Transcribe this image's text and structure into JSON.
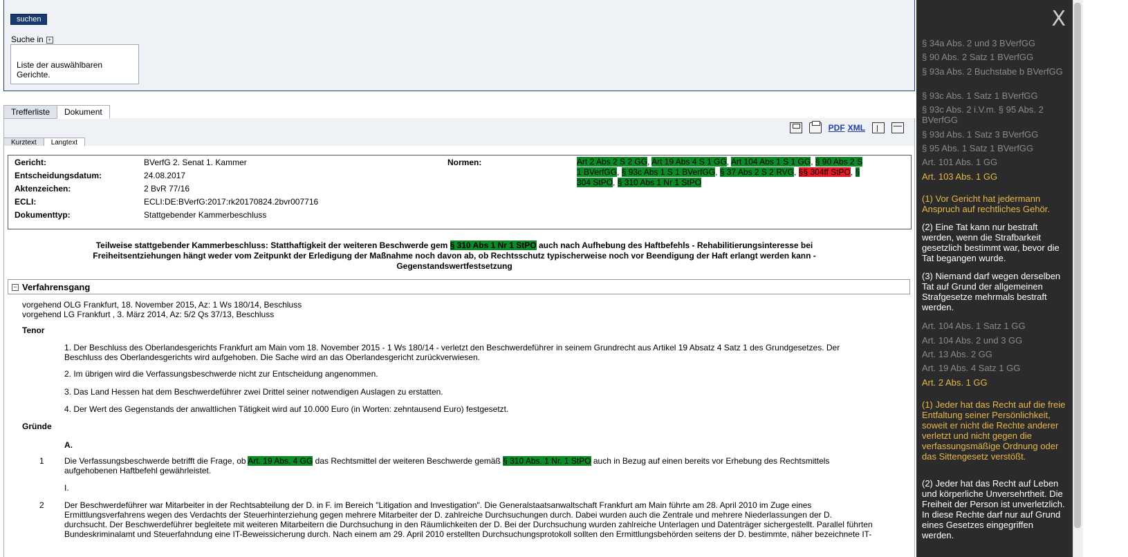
{
  "search": {
    "button_label": "suchen",
    "search_in_label": "Suche in",
    "plus_symbol": "+",
    "court_list_text": "Liste der auswählbaren Gerichte."
  },
  "tabs": [
    "Trefferliste",
    "Dokument"
  ],
  "subtabs": [
    "Kurztext",
    "Langtext"
  ],
  "toolbar": {
    "pdf_label": "PDF",
    "xml_label": "XML"
  },
  "meta": {
    "court_label": "Gericht:",
    "court_value": "BVerfG 2. Senat 1. Kammer",
    "date_label": "Entscheidungsdatum:",
    "date_value": "24.08.2017",
    "file_label": "Aktenzeichen:",
    "file_value": "2 BvR 77/16",
    "ecli_label": "ECLI:",
    "ecli_value": "ECLI:DE:BVerfG:2017:rk20170824.2bvr007716",
    "type_label": "Dokumenttyp:",
    "type_value": "Stattgebender Kammerbeschluss",
    "norms_label": "Normen:",
    "norms": [
      {
        "text": "Art 2 Abs 2 S 2 GG",
        "color": "green"
      },
      {
        "text": "Art 19 Abs 4 S 1 GG",
        "color": "green"
      },
      {
        "text": "Art 104 Abs 1 S 1 GG",
        "color": "green"
      },
      {
        "text": "§ 90 Abs 2 S 1 BVerfGG",
        "color": "green"
      },
      {
        "text": "§ 93c Abs 1 S 1 BVerfGG",
        "color": "green"
      },
      {
        "text": "§ 37 Abs 2 S 2 RVG",
        "color": "green"
      },
      {
        "text": "§§ 304ff StPO",
        "color": "red"
      },
      {
        "text": "§ 304 StPO",
        "color": "green"
      },
      {
        "text": "§ 310 Abs 1 Nr 1 StPO",
        "color": "green"
      }
    ]
  },
  "title": {
    "part1": "Teilweise stattgebender Kammerbeschluss: Statthaftigkeit der weiteren Beschwerde gem",
    "highlight": "§ 310 Abs 1 Nr 1 StPO",
    "part2": "auch nach Aufhebung des Haftbefehls - Rehabilitierungsinteresse bei Freiheitsentziehungen hängt weder vom Zeitpunkt der Erledigung der Maßnahme noch davon ab, ob Rechtsschutz typischerweise noch vor Beendigung der Haft erlangt werden kann - Gegenstandswertfestsetzung"
  },
  "section": {
    "minus_symbol": "−",
    "title": "Verfahrensgang",
    "line1": "vorgehend OLG Frankfurt, 18. November 2015, Az: 1 Ws 180/14, Beschluss",
    "line2": "vorgehend LG Frankfurt , 3. März 2014, Az: 5/2 Qs 37/13, Beschluss"
  },
  "tenor": {
    "heading": "Tenor",
    "p1": "1. Der Beschluss des Oberlandesgerichts Frankfurt am Main vom 18. November 2015 - 1 Ws 180/14 - verletzt den Beschwerdeführer in seinem Grundrecht aus Artikel 19 Absatz 4 Satz 1 des Grundgesetzes. Der Beschluss des Oberlandesgerichts wird aufgehoben. Die Sache wird an das Oberlandesgericht zurückverwiesen.",
    "p2": "2. Im übrigen wird die Verfassungsbeschwerde nicht zur Entscheidung angenommen.",
    "p3": "3. Das Land Hessen hat dem Beschwerdeführer zwei Drittel seiner notwendigen Auslagen zu erstatten.",
    "p4": "4. Der Wert des Gegenstands der anwaltlichen Tätigkeit wird auf 10.000 Euro (in Worten: zehntausend Euro) festgesetzt."
  },
  "gruende": {
    "heading": "Gründe",
    "sub_a": "A.",
    "n1": "1",
    "p1_a": "Die Verfassungsbeschwerde betrifft die Frage, ob",
    "p1_h1": "Art. 19 Abs. 4 GG",
    "p1_b": "das Rechtsmittel der weiteren Beschwerde gemäß",
    "p1_h2": "§ 310 Abs. 1 Nr. 1 StPO",
    "p1_c": "auch in Bezug auf einen bereits vor Erhebung des Rechtsmittels aufgehobenen Haftbefehl gewährleistet.",
    "sub_i": "I.",
    "n2": "2",
    "p2": "Der Beschwerdeführer war Mitarbeiter in der Rechtsabteilung der D. in F. im Bereich \"Litigation and Investigation\". Die Generalstaatsanwaltschaft Frankfurt am Main führte am 28. April 2010 im Zuge eines Ermittlungsverfahrens wegen des Verdachts der Steuerhinterziehung gegen mehrere Mitarbeiter der D. zahlreiche Durchsuchungen durch. Dabei wurden auch die Zentrale und mehrere Niederlassungen der D. durchsucht. Der Beschwerdeführer begleitete mit weiteren Mitarbeitern die Durchsuchung in den Räumlichkeiten der D. Bei der Durchsuchung wurden zahlreiche Unterlagen und Datenträger sichergestellt. Parallel führten Bundeskriminalamt und Steuerfahndung eine IT-Beweissicherung durch. Nach einem am 29. April 2010 erstellten Durchsuchungsprotokoll sollten den Ermittlungsbehörden seitens der D. bestimmte, näher bezeichnete IT-"
  },
  "sidebar": {
    "close": "X",
    "items": [
      {
        "text": "§ 34a Abs. 2 und 3 BVerfGG",
        "style": "grey"
      },
      {
        "text": "§ 90 Abs. 2 Satz 1 BVerfGG",
        "style": "grey"
      },
      {
        "text": "§ 93a Abs. 2 Buchstabe b BVerfGG",
        "style": "grey"
      },
      {
        "text": "§ 93c Abs. 1 Satz 1 BVerfGG",
        "style": "grey"
      },
      {
        "text": "§ 93c Abs. 2 i.V.m. § 95 Abs. 2 BVerfGG",
        "style": "grey"
      },
      {
        "text": "§ 93d Abs. 1 Satz 3 BVerfGG",
        "style": "grey"
      },
      {
        "text": "§ 95 Abs. 1 Satz 1 BVerfGG",
        "style": "grey"
      },
      {
        "text": "Art. 101 Abs. 1 GG",
        "style": "grey"
      },
      {
        "text": "Art. 103 Abs. 1 GG",
        "style": "gold"
      },
      {
        "text": "(1) Vor Gericht hat jedermann Anspruch auf rechtliches Gehör.",
        "style": "gold"
      },
      {
        "text": "(2) Eine Tat kann nur bestraft werden, wenn die Strafbarkeit gesetzlich bestimmt war, bevor die Tat begangen wurde.",
        "style": "white"
      },
      {
        "text": "(3) Niemand darf wegen derselben Tat auf Grund der allgemeinen Strafgesetze mehrmals bestraft werden.",
        "style": "white"
      },
      {
        "text": "Art. 104 Abs. 1 Satz 1 GG",
        "style": "grey"
      },
      {
        "text": "Art. 104 Abs. 2 und 3 GG",
        "style": "grey"
      },
      {
        "text": "Art. 13 Abs. 2 GG",
        "style": "grey"
      },
      {
        "text": "Art. 19 Abs. 4 Satz 1 GG",
        "style": "grey"
      },
      {
        "text": "Art. 2 Abs. 1 GG",
        "style": "gold"
      },
      {
        "text": "(1) Jeder hat das Recht auf die freie Entfaltung seiner Persönlichkeit, soweit er nicht die Rechte anderer verletzt und nicht gegen die verfassungsmäßige Ordnung oder das Sittengesetz verstößt.",
        "style": "gold"
      },
      {
        "text": "(2) Jeder hat das Recht auf Leben und körperliche Unversehrtheit. Die Freiheit der Person ist unverletzlich. In diese Rechte darf nur auf Grund eines Gesetzes eingegriffen werden.",
        "style": "white"
      }
    ]
  }
}
